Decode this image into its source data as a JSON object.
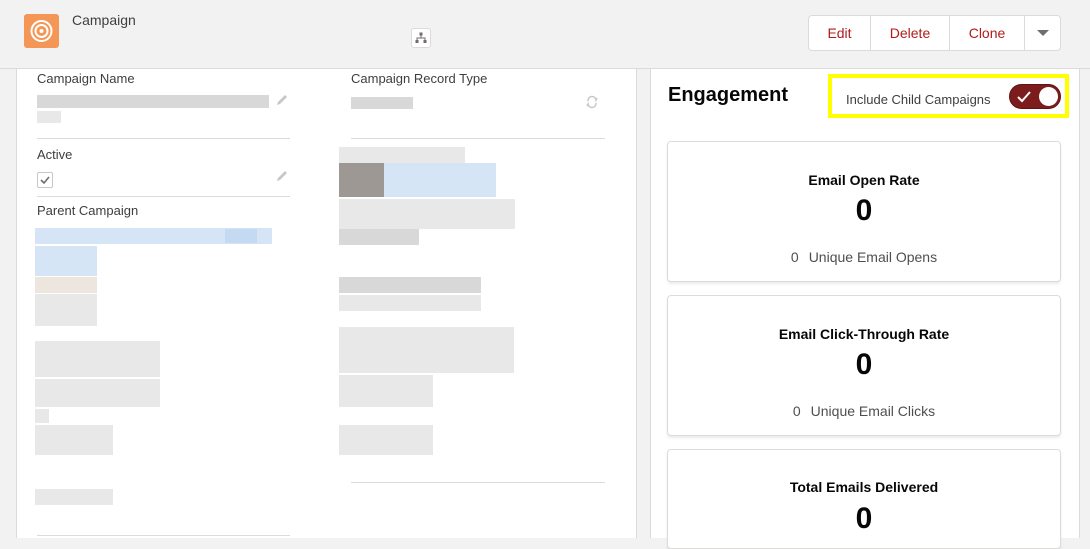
{
  "header": {
    "object_label": "Campaign",
    "actions": {
      "edit": "Edit",
      "delete": "Delete",
      "clone": "Clone"
    }
  },
  "details": {
    "campaign_name_label": "Campaign Name",
    "campaign_record_type_label": "Campaign Record Type",
    "active_label": "Active",
    "active_checked": true,
    "parent_campaign_label": "Parent Campaign"
  },
  "engagement": {
    "title": "Engagement",
    "toggle_label": "Include Child Campaigns",
    "toggle_on": true,
    "highlight_color": "#ffff00",
    "toggle_color": "#7c1c1c",
    "cards": [
      {
        "title": "Email Open Rate",
        "value": "0",
        "sub_value": "0",
        "sub_label": "Unique Email Opens"
      },
      {
        "title": "Email Click-Through Rate",
        "value": "0",
        "sub_value": "0",
        "sub_label": "Unique Email Clicks"
      },
      {
        "title": "Total Emails Delivered",
        "value": "0"
      }
    ]
  },
  "icons": {
    "app": "campaign-target-icon",
    "hierarchy": "hierarchy-icon",
    "dropdown": "chevron-down-icon",
    "edit_pencil": "pencil-icon",
    "checkbox": "checkmark-icon",
    "toggle_check": "checkmark-icon"
  },
  "colors": {
    "brand_action_text": "#b01c1c",
    "app_icon_bg": "#f49756"
  }
}
